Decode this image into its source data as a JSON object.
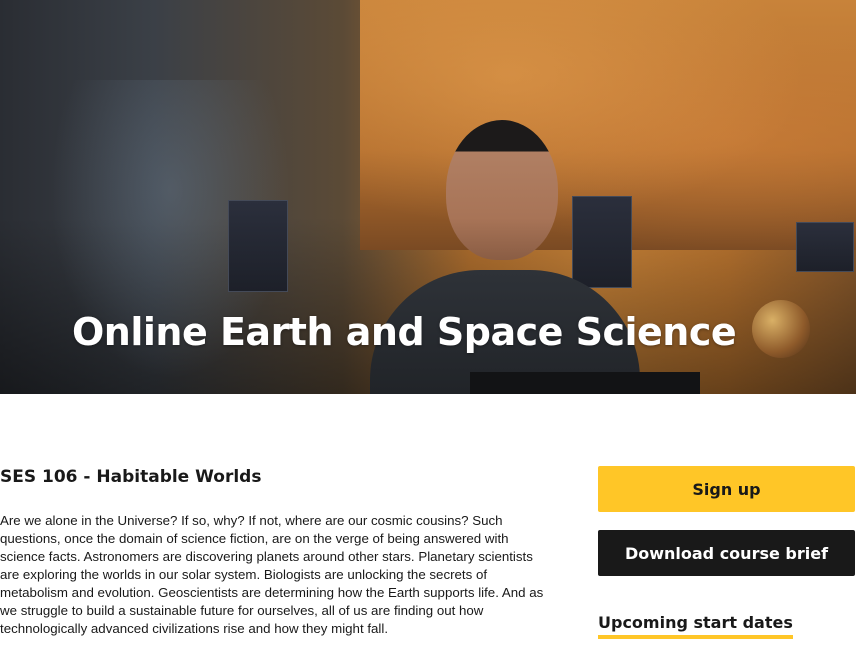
{
  "hero": {
    "title": "Online Earth and Space Science"
  },
  "course": {
    "code_title": "SES 106 - Habitable Worlds",
    "description": "Are we alone in the Universe? If so, why? If not, where are our cosmic cousins? Such questions, once the domain of science fiction, are on the verge of being answered with science facts. Astronomers are discovering planets around other stars. Planetary scientists are exploring the worlds in our solar system. Biologists are unlocking the secrets of metabolism and evolution. Geoscientists are determining how the Earth supports life. And as we struggle to build a sustainable future for ourselves, all of us are finding out how technologically advanced civilizations rise and how they might fall."
  },
  "actions": {
    "signup_label": "Sign up",
    "download_label": "Download course brief"
  },
  "sidebar": {
    "upcoming_heading": "Upcoming start dates"
  },
  "colors": {
    "accent": "#ffc627",
    "dark": "#191919",
    "text": "#191919"
  }
}
